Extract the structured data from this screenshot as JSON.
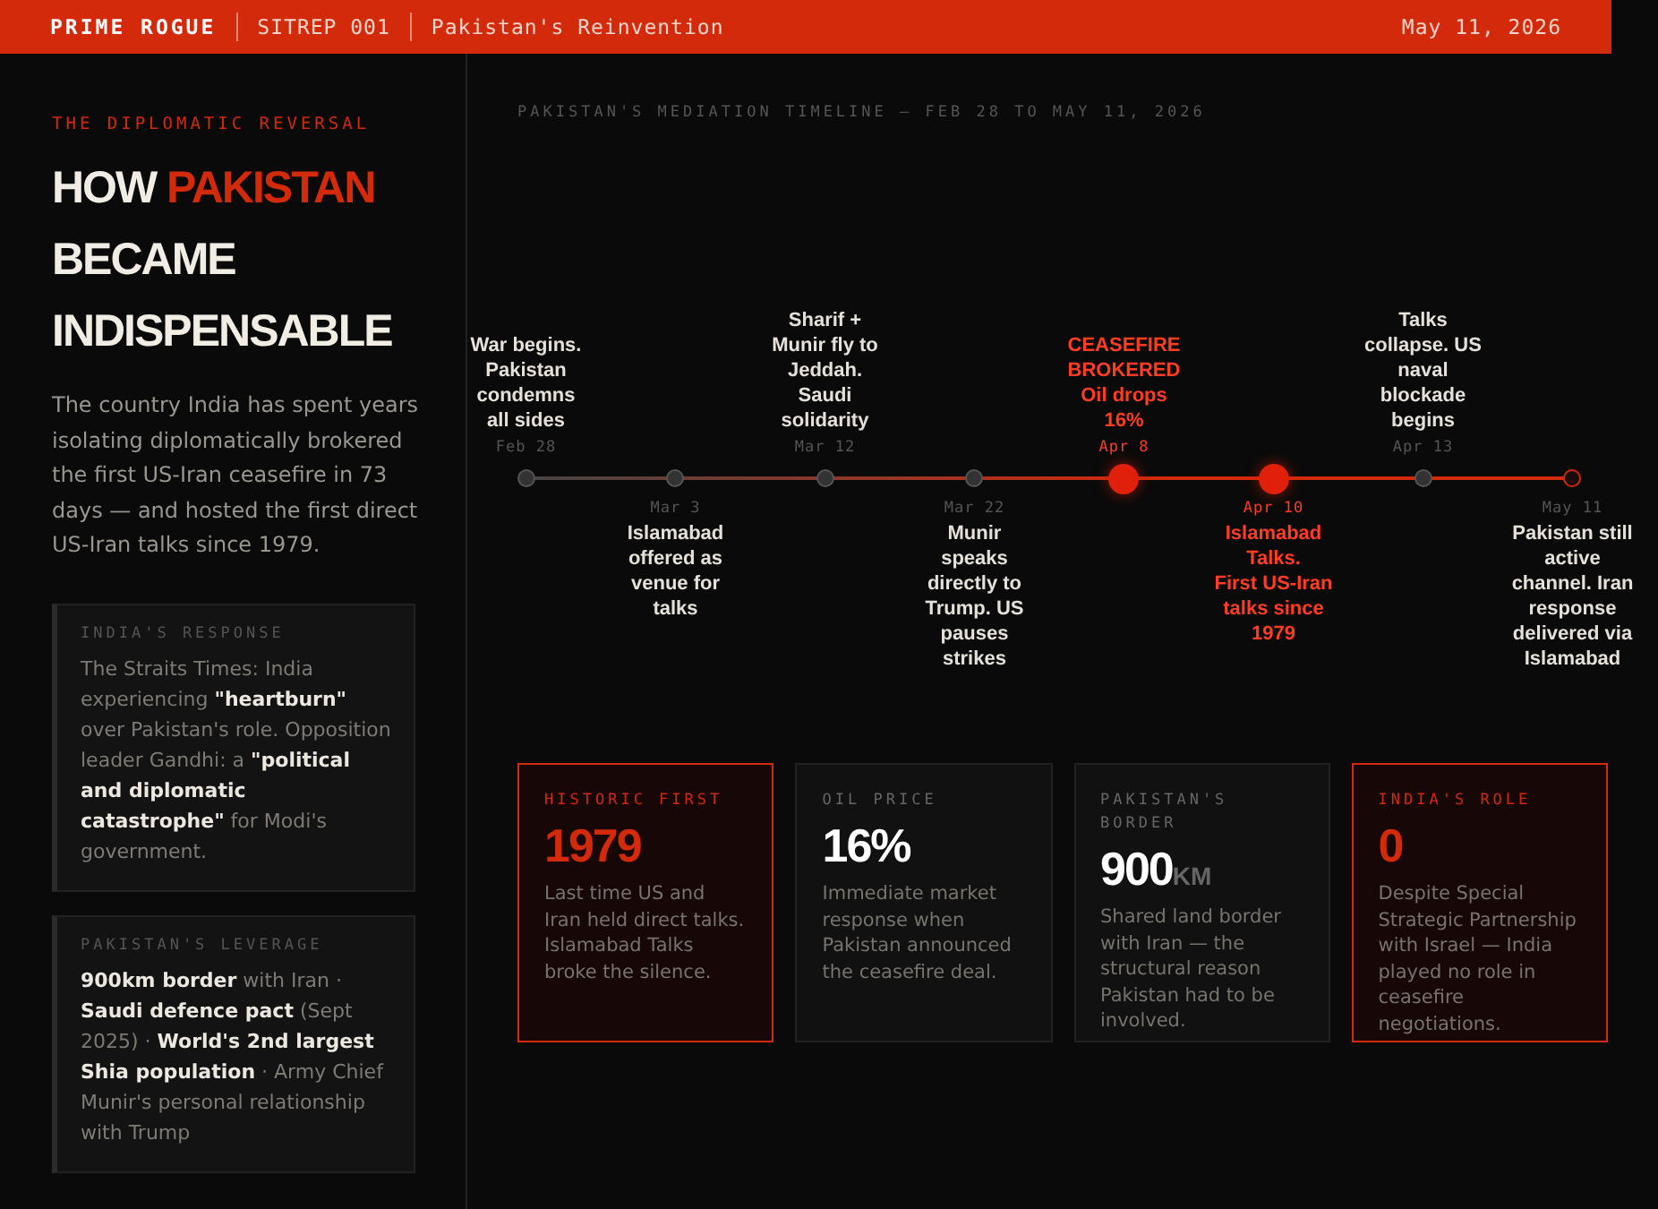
{
  "header": {
    "brand": "PRIME ROGUE",
    "issue": "SITREP 001",
    "title": "Pakistan's Reinvention",
    "date": "May 11, 2026"
  },
  "sidebar": {
    "kicker": "THE DIPLOMATIC REVERSAL",
    "headline": [
      {
        "text": "HOW ",
        "accent": false
      },
      {
        "text": "PAKISTAN",
        "accent": true
      },
      {
        "text": " BECAME INDISPENSABLE",
        "accent": false
      }
    ],
    "summary": "The country India has spent years isolating diplomatically brokered the first US-Iran ceasefire in 73 days — and hosted the first direct US-Iran talks since 1979.",
    "panels": [
      {
        "label": "INDIA'S RESPONSE",
        "text": "The Straits Times: India experiencing **\"heartburn\"** over Pakistan's role. Opposition leader Gandhi: a **\"political and diplomatic catastrophe\"** for Modi's government."
      },
      {
        "label": "PAKISTAN'S LEVERAGE",
        "text": "**900km border** with Iran · **Saudi defence pact** (Sept 2025) · **World's 2nd largest Shia population** · Army Chief Munir's personal relationship with Trump"
      }
    ]
  },
  "timeline": {
    "title": "PAKISTAN'S MEDIATION TIMELINE — FEB 28 TO MAY 11, 2026",
    "events": [
      {
        "date": "Feb 28",
        "text": "War begins. Pakistan condemns all sides",
        "above": true,
        "highlight": false,
        "current": false
      },
      {
        "date": "Mar 3",
        "text": "Islamabad offered as venue for talks",
        "above": false,
        "highlight": false,
        "current": false
      },
      {
        "date": "Mar 12",
        "text": "Sharif + Munir fly to Jeddah. Saudi solidarity",
        "above": true,
        "highlight": false,
        "current": false
      },
      {
        "date": "Mar 22",
        "text": "Munir speaks directly to Trump. US pauses strikes",
        "above": false,
        "highlight": false,
        "current": false
      },
      {
        "date": "Apr 8",
        "heading": "CEASEFIRE BROKERED",
        "text": "Oil drops 16%",
        "above": true,
        "highlight": true,
        "current": false
      },
      {
        "date": "Apr 10",
        "heading": "Islamabad Talks.",
        "text": "First US-Iran talks since 1979",
        "above": false,
        "highlight": true,
        "current": false
      },
      {
        "date": "Apr 13",
        "text": "Talks collapse. US naval blockade begins",
        "above": true,
        "highlight": false,
        "current": false
      },
      {
        "date": "May 11",
        "text": "Pakistan still active channel. Iran response delivered via Islamabad",
        "above": false,
        "highlight": false,
        "current": true
      }
    ]
  },
  "stats": [
    {
      "label": "HISTORIC FIRST",
      "value": "1979",
      "text": "Last time US and Iran held direct talks. Islamabad Talks broke the silence.",
      "kind": "highlight"
    },
    {
      "label": "OIL PRICE",
      "value": "16%",
      "text": "Immediate market response when Pakistan announced the ceasefire deal.",
      "kind": "plain"
    },
    {
      "label": "PAKISTAN'S BORDER",
      "value": "900",
      "unit": "KM",
      "text": "Shared land border with Iran — the structural reason Pakistan had to be involved.",
      "kind": "plain"
    },
    {
      "label": "INDIA'S ROLE",
      "value": "0",
      "text": "Despite Special Strategic Partnership with Israel — India played no role in ceasefire negotiations.",
      "kind": "highlight"
    }
  ]
}
